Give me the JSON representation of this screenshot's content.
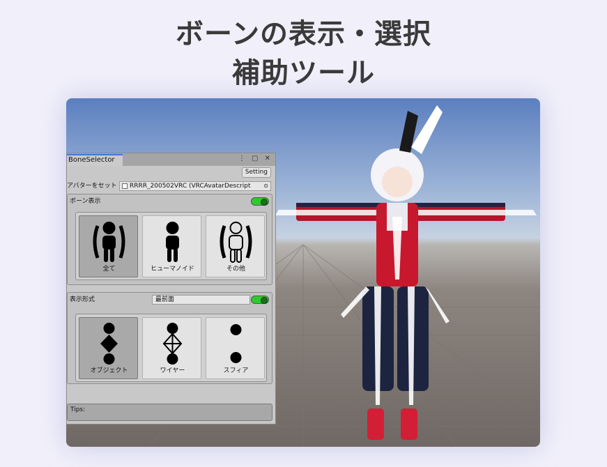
{
  "headline": {
    "line1": "ボーンの表示・選択",
    "line2": "補助ツール"
  },
  "window": {
    "tab_title": "BoneSelector",
    "window_icons": "⋮ ▢ ✕",
    "setting_button": "Setting",
    "avatar_label": "アバターをセット →",
    "avatar_value": "RRRR_200502VRC (VRCAvatarDescript",
    "avatar_picker_icon": "⊙"
  },
  "bone_display": {
    "label": "ボーン表示",
    "enabled": true,
    "options": [
      {
        "label": "全て",
        "icon": "person-brackets-icon",
        "selected": true
      },
      {
        "label": "ヒューマノイド",
        "icon": "person-icon",
        "selected": false
      },
      {
        "label": "その他",
        "icon": "person-outline-brackets-icon",
        "selected": false
      }
    ]
  },
  "display_format": {
    "label": "表示形式",
    "dropdown_value": "最前面",
    "enabled": true,
    "options": [
      {
        "label": "オブジェクト",
        "icon": "bone-object-icon",
        "selected": true
      },
      {
        "label": "ワイヤー",
        "icon": "bone-wire-icon",
        "selected": false
      },
      {
        "label": "スフィア",
        "icon": "bone-sphere-icon",
        "selected": false
      }
    ]
  },
  "tips": {
    "label": "Tips:"
  },
  "colors": {
    "toggle_on": "#2bcb2b",
    "tab_accent": "#3a79d8",
    "selected_tile": "#a9a9a9"
  }
}
